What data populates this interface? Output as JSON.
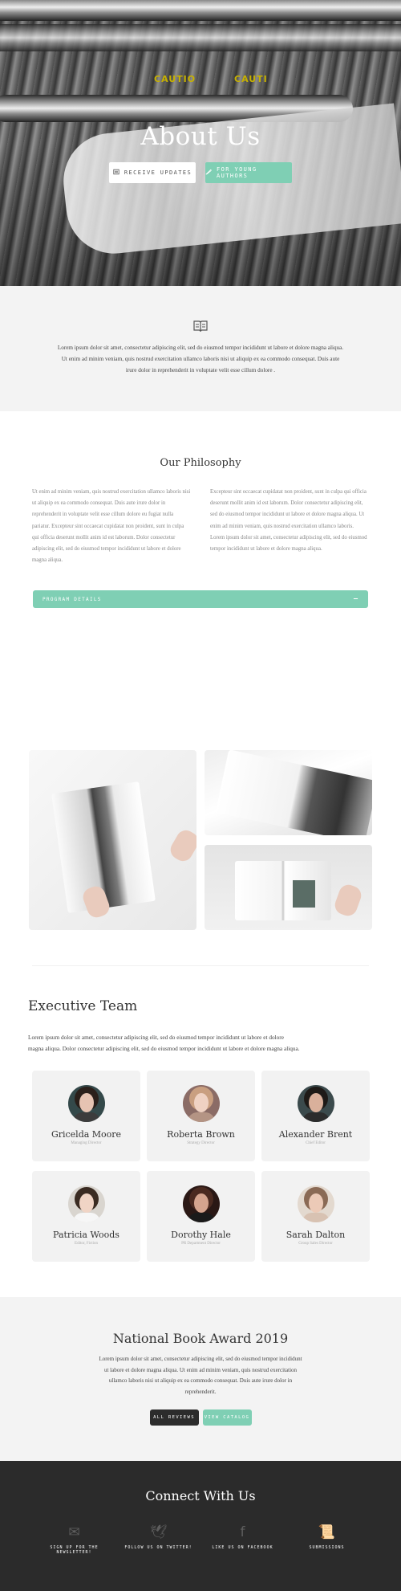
{
  "hero": {
    "title": "About Us",
    "buttons": [
      {
        "label": "Receive Updates",
        "icon": "newspaper-icon"
      },
      {
        "label": "For Young Authors",
        "icon": "quill-icon"
      }
    ],
    "machine_labels": [
      "CAUTIO",
      "CAUTI"
    ]
  },
  "intro": {
    "icon": "open-book-icon",
    "text": "Lorem ipsum dolor sit amet, consectetur adipiscing elit, sed do eiusmod tempor incididunt ut  labore et dolore magna aliqua. Ut enim ad minim veniam, quis nostrud exercitation ullamco laboris  nisi ut aliquip ex ea commodo consequat. Duis aute irure dolor in reprehenderit in voluptate  velit esse cillum dolore ."
  },
  "philosophy": {
    "title": "Our Philosophy",
    "col_left": "Ut enim ad minim veniam, quis nostrud exercitation ullamco laboris nisi ut aliquip ex ea commodo consequat. Duis aute irure dolor in reprehenderit in voluptate velit esse cillum dolore eu fugiat nulla pariatur. Excepteur sint occaecat cupidatat non proident, sunt in culpa qui officia deserunt mollit anim id est laborum. Dolor consectetur adipiscing elit, sed do eiusmod tempor incididunt ut labore et dolore magna aliqua.",
    "col_right": "Excepteur sint occaecat cupidatat non proident, sunt in culpa qui officia deserunt mollit anim id est laborum. Dolor consectetur adipiscing elit, sed do eiusmod tempor incididunt ut labore et dolore magna aliqua. Ut enim ad minim veniam, quis nostrud exercitation ullamco laboris. Lorem ipsum dolor sit amet, consectetur adipiscing elit, sed do eiusmod tempor incididunt ut labore et dolore magna aliqua.",
    "accordion_label": "Program Details",
    "accordion_icon": "minus-icon"
  },
  "team": {
    "title": "Executive Team",
    "lead": "Lorem ipsum dolor sit amet, consectetur adipiscing elit, sed do eiusmod tempor incididunt ut labore et dolore magna aliqua. Dolor consectetur adipiscing elit, sed do eiusmod tempor incididunt ut labore et dolore magna aliqua.",
    "members": [
      {
        "name": "Gricelda Moore",
        "role": "Managing Director"
      },
      {
        "name": "Roberta Brown",
        "role": "Strategy Director"
      },
      {
        "name": "Alexander Brent",
        "role": "Chief Editor"
      },
      {
        "name": "Patricia Woods",
        "role": "Editor, Fiction"
      },
      {
        "name": "Dorothy Hale",
        "role": "PR Department Director"
      },
      {
        "name": "Sarah Dalton",
        "role": "Group Sales Director"
      }
    ]
  },
  "award": {
    "title": "National Book Award 2019",
    "text": "Lorem ipsum dolor sit amet, consectetur adipiscing elit, sed do eiusmod tempor incididunt ut labore et dolore magna aliqua. Ut enim ad minim veniam, quis nostrud exercitation ullamco laboris nisi ut aliquip ex ea commodo consequat. Duis aute irure dolor in reprehenderit.",
    "button_reviews": "All Reviews",
    "button_catalog": "View Catalog"
  },
  "footer": {
    "title": "Connect With Us",
    "links": [
      {
        "label": "Sign up for the newsletter!",
        "icon": "envelope-icon",
        "glyph": "✉"
      },
      {
        "label": "Follow us on Twitter!",
        "icon": "twitter-bird-icon",
        "glyph": "🕊"
      },
      {
        "label": "Like us on Facebook",
        "icon": "facebook-icon",
        "glyph": "f"
      },
      {
        "label": "Submissions",
        "icon": "scroll-icon",
        "glyph": "📜"
      }
    ]
  },
  "colors": {
    "accent": "#7fcfb4",
    "dark": "#2b2b2b",
    "light_bg": "#f3f3f3"
  }
}
